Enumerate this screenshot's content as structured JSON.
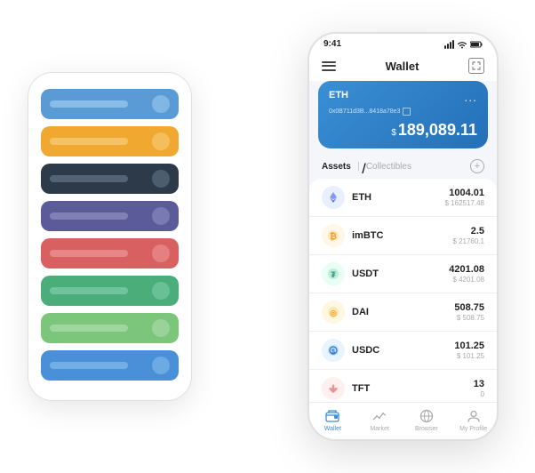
{
  "scene": {
    "bg_phone": {
      "cards": [
        {
          "class": "card-blue",
          "id": "card-1"
        },
        {
          "class": "card-orange",
          "id": "card-2"
        },
        {
          "class": "card-dark",
          "id": "card-3"
        },
        {
          "class": "card-purple",
          "id": "card-4"
        },
        {
          "class": "card-red",
          "id": "card-5"
        },
        {
          "class": "card-green",
          "id": "card-6"
        },
        {
          "class": "card-lightgreen",
          "id": "card-7"
        },
        {
          "class": "card-blue2",
          "id": "card-8"
        }
      ]
    },
    "main_phone": {
      "status": {
        "time": "9:41",
        "signal": "●●●",
        "wifi": "WiFi",
        "battery": "🔋"
      },
      "header": {
        "menu_label": "≡",
        "title": "Wallet",
        "expand_label": "⤢"
      },
      "eth_card": {
        "label": "ETH",
        "dots": "...",
        "address": "0x0B711d3B...8418a78e3",
        "copy_icon": "⧉",
        "amount": "189,089.11",
        "currency_prefix": "$"
      },
      "assets_section": {
        "tab_active": "Assets",
        "tab_divider": "/",
        "tab_inactive": "Collectibles",
        "add_btn": "+"
      },
      "assets": [
        {
          "icon": "◆",
          "icon_class": "icon-eth",
          "name": "ETH",
          "amount": "1004.01",
          "usd": "$ 162517.48"
        },
        {
          "icon": "₿",
          "icon_class": "icon-imbtc",
          "name": "imBTC",
          "amount": "2.5",
          "usd": "$ 21760.1"
        },
        {
          "icon": "₮",
          "icon_class": "icon-usdt",
          "name": "USDT",
          "amount": "4201.08",
          "usd": "$ 4201.08"
        },
        {
          "icon": "◎",
          "icon_class": "icon-dai",
          "name": "DAI",
          "amount": "508.75",
          "usd": "$ 508.75"
        },
        {
          "icon": "©",
          "icon_class": "icon-usdc",
          "name": "USDC",
          "amount": "101.25",
          "usd": "$ 101.25"
        },
        {
          "icon": "🦋",
          "icon_class": "icon-tft",
          "name": "TFT",
          "amount": "13",
          "usd": "0"
        }
      ],
      "nav": [
        {
          "icon": "◎",
          "label": "Wallet",
          "active": true
        },
        {
          "icon": "📈",
          "label": "Market",
          "active": false
        },
        {
          "icon": "🌐",
          "label": "Browser",
          "active": false
        },
        {
          "icon": "👤",
          "label": "My Profile",
          "active": false
        }
      ]
    }
  }
}
